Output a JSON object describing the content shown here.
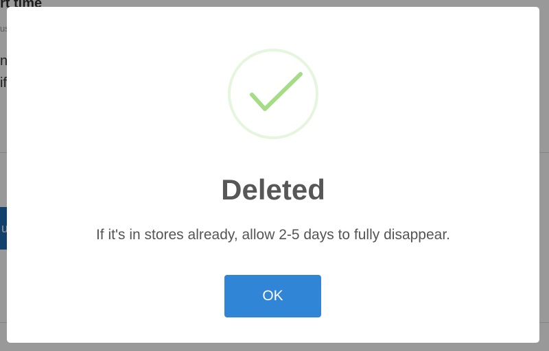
{
  "background": {
    "heading": "rt time",
    "subtext": "us",
    "line1": "ng",
    "line2": "if",
    "button_label": "u"
  },
  "dialog": {
    "icon": "checkmark-success-icon",
    "title": "Deleted",
    "message": "If it's in stores already, allow 2-5 days to fully disappear.",
    "ok_label": "OK"
  },
  "colors": {
    "accent": "#3085d6",
    "success": "#a5dc86",
    "title_text": "#575757",
    "body_text": "#545454",
    "overlay": "rgba(0,0,0,0.4)",
    "background_button": "#1f6fb5"
  }
}
